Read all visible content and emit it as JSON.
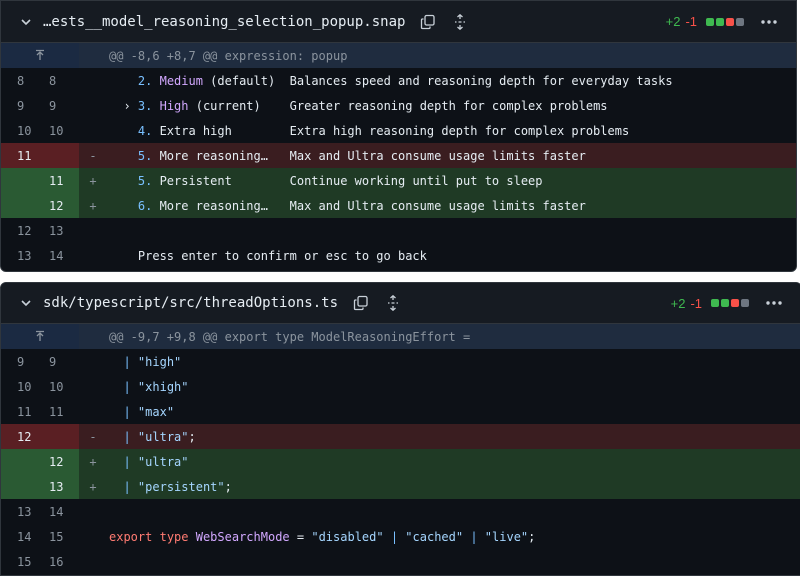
{
  "files": [
    {
      "name": "…ests__model_reasoning_selection_popup.snap",
      "additions": "+2",
      "deletions": "-1",
      "hunk_header": "@@ -8,6 +8,7 @@ expression: popup",
      "lines": [
        {
          "old": "8",
          "new": "8",
          "sign": "",
          "type": "ctx",
          "code": "    2. Medium (default)  Balances speed and reasoning depth for everyday tasks"
        },
        {
          "old": "9",
          "new": "9",
          "sign": "",
          "type": "ctx",
          "code": "  › 3. High (current)    Greater reasoning depth for complex problems"
        },
        {
          "old": "10",
          "new": "10",
          "sign": "",
          "type": "ctx",
          "code": "    4. Extra high        Extra high reasoning depth for complex problems"
        },
        {
          "old": "11",
          "new": "",
          "sign": "-",
          "type": "del",
          "code": "    5. More reasoning…   Max and Ultra consume usage limits faster"
        },
        {
          "old": "",
          "new": "11",
          "sign": "+",
          "type": "add",
          "code": "    5. Persistent        Continue working until put to sleep"
        },
        {
          "old": "",
          "new": "12",
          "sign": "+",
          "type": "add",
          "code": "    6. More reasoning…   Max and Ultra consume usage limits faster"
        },
        {
          "old": "12",
          "new": "13",
          "sign": "",
          "type": "ctx",
          "code": ""
        },
        {
          "old": "13",
          "new": "14",
          "sign": "",
          "type": "ctx",
          "code": "    Press enter to confirm or esc to go back"
        }
      ]
    },
    {
      "name": "sdk/typescript/src/threadOptions.ts",
      "additions": "+2",
      "deletions": "-1",
      "hunk_header": "@@ -9,7 +9,8 @@ export type ModelReasoningEffort =",
      "lines": [
        {
          "old": "9",
          "new": "9",
          "sign": "",
          "type": "ctx",
          "code": "  | \"high\""
        },
        {
          "old": "10",
          "new": "10",
          "sign": "",
          "type": "ctx",
          "code": "  | \"xhigh\""
        },
        {
          "old": "11",
          "new": "11",
          "sign": "",
          "type": "ctx",
          "code": "  | \"max\""
        },
        {
          "old": "12",
          "new": "",
          "sign": "-",
          "type": "del",
          "code": "  | \"ultra\";"
        },
        {
          "old": "",
          "new": "12",
          "sign": "+",
          "type": "add",
          "code": "  | \"ultra\""
        },
        {
          "old": "",
          "new": "13",
          "sign": "+",
          "type": "add",
          "code": "  | \"persistent\";"
        },
        {
          "old": "13",
          "new": "14",
          "sign": "",
          "type": "ctx",
          "code": ""
        },
        {
          "old": "14",
          "new": "15",
          "sign": "",
          "type": "ctx",
          "code": "export type WebSearchMode = \"disabled\" | \"cached\" | \"live\";"
        },
        {
          "old": "15",
          "new": "16",
          "sign": "",
          "type": "ctx",
          "code": ""
        }
      ]
    }
  ],
  "colors": {
    "diff_block_add": "#3fb950",
    "diff_block_del": "#f85149",
    "diff_block_neutral": "#6e7681"
  },
  "icons": {
    "collapse": "chevron-down-icon",
    "copy": "copy-icon",
    "expand": "unfold-icon",
    "more": "kebab-icon",
    "expand_up": "expand-up-icon"
  }
}
